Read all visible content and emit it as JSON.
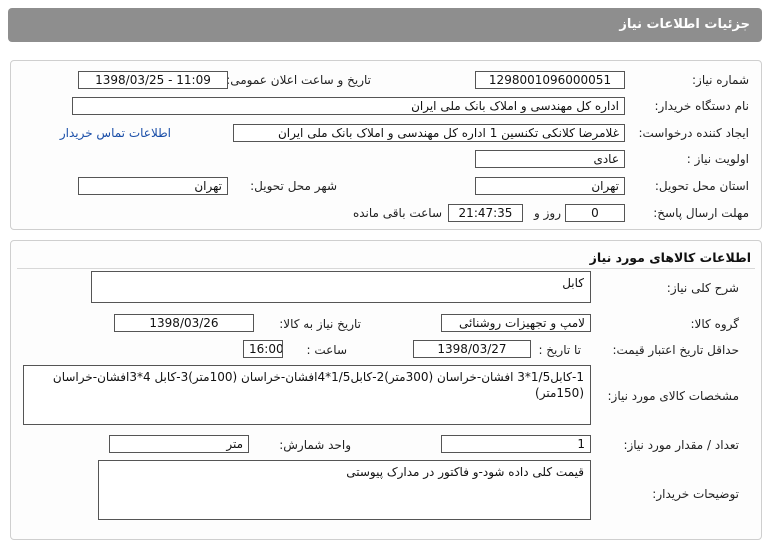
{
  "header": {
    "title": "جزئیات اطلاعات نیاز"
  },
  "need": {
    "number_label": "شماره نیاز:",
    "number": "1298001096000051",
    "announce_label": "تاریخ و ساعت اعلان عمومی:",
    "announce_value": "1398/03/25 - 11:09",
    "buyer_label": "نام دستگاه خریدار:",
    "buyer": "اداره کل مهندسی و املاک بانک ملی ایران",
    "requester_label": "ایجاد کننده درخواست:",
    "requester": "غلامرضا کلانکی تکنسین 1 اداره کل مهندسی و املاک بانک ملی ایران",
    "contact_link": "اطلاعات تماس خریدار",
    "priority_label": "اولویت نیاز :",
    "priority": "عادی",
    "province_label": "استان محل تحویل:",
    "province": "تهران",
    "city_label": "شهر محل تحویل:",
    "city": "تهران",
    "deadline_label": "مهلت ارسال پاسخ:",
    "days": "0",
    "days_unit": "روز و",
    "time": "21:47:35",
    "time_suffix": "ساعت باقی مانده"
  },
  "goods": {
    "section_title": "اطلاعات کالاهای مورد نیاز",
    "summary_label": "شرح کلی نیاز:",
    "summary": "کابل",
    "group_label": "گروه کالا:",
    "group": "لامپ و تجهیزات روشنائی",
    "need_date_label": "تاریخ نیاز به کالا:",
    "need_date": "1398/03/26",
    "validity_label": "حداقل تاریخ اعتبار قیمت:",
    "until_label": "تا تاریخ :",
    "validity_date": "1398/03/27",
    "hour_label": "ساعت :",
    "validity_time": "16:00",
    "specs_label": "مشخصات کالای مورد نیاز:",
    "specs": "1-کابل1/5*3 افشان-خراسان (300متر)2-کابل1/5*4افشان-خراسان (100متر)3-کابل 4*3افشان-خراسان (150متر)",
    "quantity_label": "تعداد / مقدار مورد نیاز:",
    "quantity": "1",
    "unit_label": "واحد شمارش:",
    "unit": "متر",
    "notes_label": "توضیحات خریدار:",
    "notes": "قیمت کلی داده شود-و فاکتور در مدارک پیوستی"
  }
}
